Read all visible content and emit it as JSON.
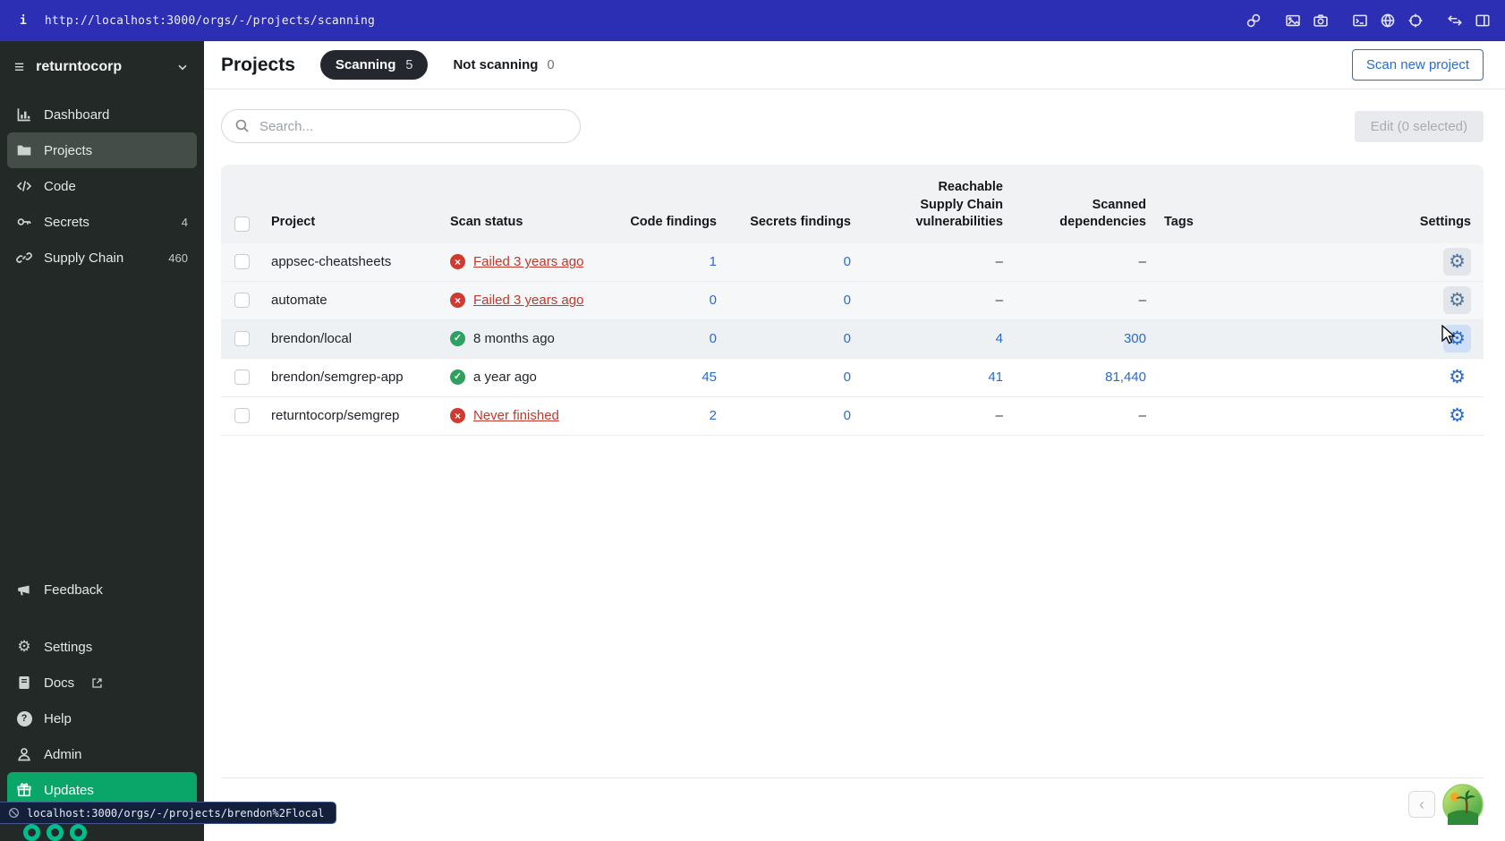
{
  "topbar": {
    "mode": "i",
    "url": "http://localhost:3000/orgs/-/projects/scanning",
    "icons": [
      "link",
      "image",
      "camera",
      "terminal",
      "globe",
      "crosshair",
      "swap-arrows",
      "split-panel"
    ]
  },
  "status_bar": {
    "link": "localhost:3000/orgs/-/projects/brendon%2Flocal"
  },
  "sidebar": {
    "org": "returntocorp",
    "items": [
      {
        "label": "Dashboard",
        "badge": ""
      },
      {
        "label": "Projects",
        "badge": ""
      },
      {
        "label": "Code",
        "badge": ""
      },
      {
        "label": "Secrets",
        "badge": "4"
      },
      {
        "label": "Supply Chain",
        "badge": "460"
      }
    ],
    "bottom_items": [
      {
        "label": "Feedback"
      },
      {
        "label": "Settings"
      },
      {
        "label": "Docs"
      },
      {
        "label": "Help"
      },
      {
        "label": "Admin"
      },
      {
        "label": "Updates"
      }
    ]
  },
  "page": {
    "title": "Projects",
    "tabs": [
      {
        "label": "Scanning",
        "count": "5",
        "active": true
      },
      {
        "label": "Not scanning",
        "count": "0",
        "active": false
      }
    ],
    "scan_new": "Scan new project"
  },
  "toolbar": {
    "search_placeholder": "Search...",
    "edit": "Edit (0 selected)"
  },
  "table": {
    "headers": [
      "Project",
      "Scan status",
      "Code findings",
      "Secrets findings",
      "Reachable Supply Chain vulnerabilities",
      "Scanned dependencies",
      "Tags",
      "Settings"
    ],
    "rows": [
      {
        "project": "appsec-cheatsheets",
        "status": "Failed 3 years ago",
        "status_kind": "failed",
        "code": "1",
        "secrets": "0",
        "reachable": "–",
        "deps": "–",
        "tags": ""
      },
      {
        "project": "automate",
        "status": "Failed 3 years ago",
        "status_kind": "failed",
        "code": "0",
        "secrets": "0",
        "reachable": "–",
        "deps": "–",
        "tags": ""
      },
      {
        "project": "brendon/local",
        "status": "8 months ago",
        "status_kind": "success",
        "code": "0",
        "secrets": "0",
        "reachable": "4",
        "deps": "300",
        "tags": ""
      },
      {
        "project": "brendon/semgrep-app",
        "status": "a year ago",
        "status_kind": "success",
        "code": "45",
        "secrets": "0",
        "reachable": "41",
        "deps": "81,440",
        "tags": ""
      },
      {
        "project": "returntocorp/semgrep",
        "status": "Never finished",
        "status_kind": "failed",
        "code": "2",
        "secrets": "0",
        "reachable": "–",
        "deps": "–",
        "tags": ""
      }
    ]
  },
  "footer": {
    "prev": "‹"
  },
  "colors": {
    "topbar_bg": "#2c2eb4",
    "sidebar_bg": "#222926",
    "accent_blue": "#2b6bd0",
    "success_green": "#2ea05f",
    "failed_red": "#cf3b30",
    "updates_green": "#0aa568",
    "logo_teal": "#00bd8e"
  }
}
